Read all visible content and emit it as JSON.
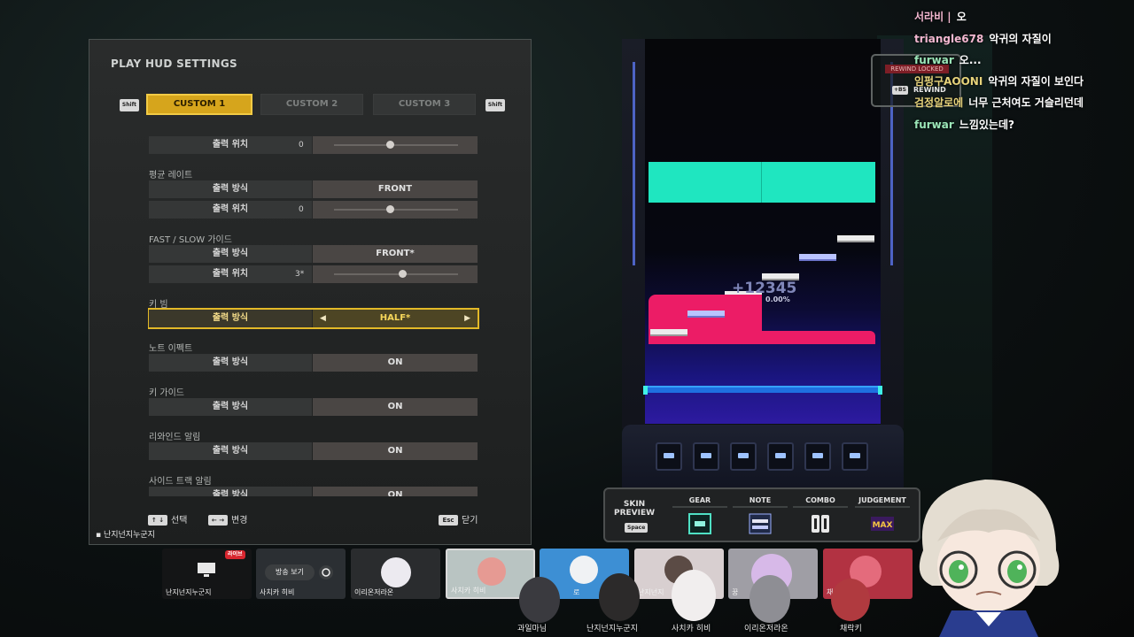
{
  "hud": {
    "title": "PLAY HUD SETTINGS",
    "shift_key": "Shift",
    "tabs": [
      {
        "label": "CUSTOM 1",
        "active": true
      },
      {
        "label": "CUSTOM 2",
        "active": false
      },
      {
        "label": "CUSTOM 3",
        "active": false
      }
    ],
    "partial_row": {
      "label": "출력 위치",
      "value": "0",
      "slider": 0.45
    },
    "sections": [
      {
        "title": "평균 레이트",
        "rows": [
          {
            "label": "출력 방식",
            "value": "FRONT"
          },
          {
            "label": "출력 위치",
            "value": "0",
            "slider": 0.45
          }
        ]
      },
      {
        "title": "FAST / SLOW 가이드",
        "rows": [
          {
            "label": "출력 방식",
            "value": "FRONT*"
          },
          {
            "label": "출력 위치",
            "value": "3*",
            "slider": 0.55
          }
        ]
      },
      {
        "title": "키 빔",
        "rows": [
          {
            "label": "출력 방식",
            "value": "HALF*",
            "focused": true
          }
        ]
      },
      {
        "title": "노트 이펙트",
        "rows": [
          {
            "label": "출력 방식",
            "value": "ON"
          }
        ]
      },
      {
        "title": "키 가이드",
        "rows": [
          {
            "label": "출력 방식",
            "value": "ON"
          }
        ]
      },
      {
        "title": "리와인드 알림",
        "rows": [
          {
            "label": "출력 방식",
            "value": "ON"
          }
        ]
      },
      {
        "title": "사이드 트랙 알림",
        "rows": [
          {
            "label": "출력 방식",
            "value": "ON"
          }
        ]
      }
    ],
    "footer": {
      "select_keys": "↑ ↓",
      "select_label": "선택",
      "change_keys": "← →",
      "change_label": "변경",
      "close_key": "Esc",
      "close_label": "닫기"
    },
    "caption": "난지넌지누군지"
  },
  "game": {
    "score": "+12345",
    "percent": "0.00%",
    "rewind_locked": "REWIND LOCKED",
    "rewind_key": "+BS",
    "rewind_label": "REWIND",
    "pad_count": 6
  },
  "skin_preview": {
    "title_line1": "SKIN",
    "title_line2": "PREVIEW",
    "space_key": "Space",
    "columns": [
      "GEAR",
      "NOTE",
      "COMBO",
      "JUDGEMENT"
    ],
    "judgement_icon_text": "MAX"
  },
  "chat": [
    {
      "nick": "서라비 |",
      "msg": "오",
      "color": "#f3b7d0"
    },
    {
      "nick": "triangle678",
      "msg": "악귀의 자질이",
      "color": "#f3b7d0"
    },
    {
      "nick": "furwar",
      "msg": "오...",
      "color": "#9be6b8"
    },
    {
      "nick": "임펑구AOONI",
      "msg": "악귀의 자질이 보인다",
      "color": "#e6d27a"
    },
    {
      "nick": "검정알로에",
      "msg": "너무 근처여도 거슬리던데",
      "color": "#e6d27a"
    },
    {
      "nick": "furwar",
      "msg": "느낌있는데?",
      "color": "#9be6b8"
    }
  ],
  "stream_strip": {
    "live_badge": "라이브",
    "tiles": [
      {
        "name": "난지넌지누군지",
        "color": "#141516",
        "button": ""
      },
      {
        "name": "사치카 히비",
        "color": "#2b2f33",
        "button": "방송 보기"
      },
      {
        "name": "이리온저라온",
        "color": "#2a2c2e",
        "button": ""
      },
      {
        "name": "사치카 히비",
        "color": "#b9c4c2",
        "button": ""
      },
      {
        "name": "로",
        "color": "#3d8fd4",
        "button": ""
      },
      {
        "name": "난지넌지",
        "color": "#d8cfd0",
        "button": ""
      },
      {
        "name": "꿍",
        "color": "#9f9ea5",
        "button": ""
      },
      {
        "name": "채",
        "color": "#b23242",
        "button": ""
      }
    ],
    "bottom_names": [
      "과일마님",
      "난지넌지누군지",
      "사치카 히비",
      "이리온저라온",
      "채락키"
    ]
  },
  "colors": {
    "accent": "#d6a51c",
    "lane_top": "#1fe6c0",
    "pink_note": "#ec1c66",
    "judge_line": "#1e6fe0"
  }
}
